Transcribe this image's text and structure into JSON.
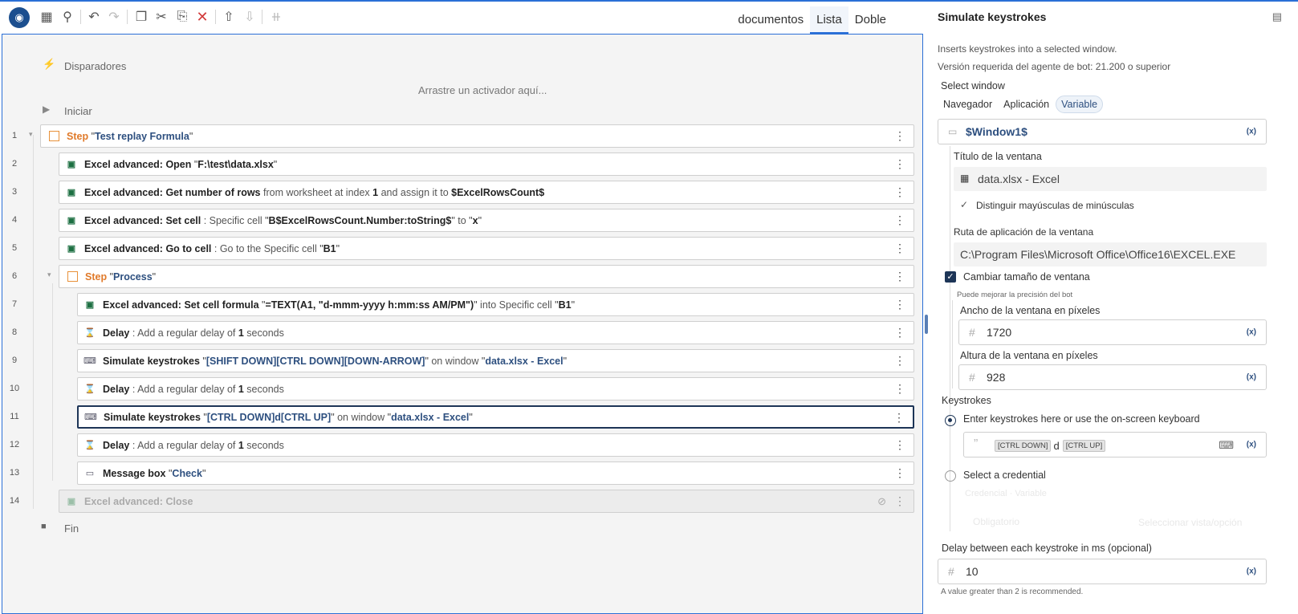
{
  "toolbar": {
    "icons": [
      "record-icon",
      "search-window-icon",
      "search-icon",
      "undo-icon",
      "redo-icon",
      "copy-icon",
      "cut-icon",
      "paste-icon",
      "delete-icon",
      "export-icon",
      "import-icon",
      "disable-icon"
    ],
    "views": [
      "documentos",
      "Lista",
      "Doble"
    ],
    "active_view": "Lista"
  },
  "canvas": {
    "triggers_label": "Disparadores",
    "drop_hint": "Arrastre un activador aquí...",
    "start_label": "Iniciar",
    "end_label": "Fin",
    "rows": [
      {
        "num": "1",
        "kind": "step",
        "parts": [
          {
            "t": "Step ",
            "c": "o"
          },
          {
            "t": "\"",
            "c": "q"
          },
          {
            "t": "Test replay Formula",
            "c": "bl"
          },
          {
            "t": "\"",
            "c": "q"
          }
        ]
      },
      {
        "num": "2",
        "kind": "excel",
        "parts": [
          {
            "t": "Excel advanced: Open ",
            "c": "b"
          },
          {
            "t": "\"",
            "c": "q"
          },
          {
            "t": "F:\\test\\data.xlsx",
            "c": "b"
          },
          {
            "t": "\"",
            "c": "q"
          }
        ]
      },
      {
        "num": "3",
        "kind": "excel",
        "parts": [
          {
            "t": "Excel advanced: Get number of rows ",
            "c": "b"
          },
          {
            "t": "from worksheet at index ",
            "c": "n"
          },
          {
            "t": "1",
            "c": "b"
          },
          {
            "t": " and assign it to ",
            "c": "n"
          },
          {
            "t": "$ExcelRowsCount$",
            "c": "b"
          }
        ]
      },
      {
        "num": "4",
        "kind": "excel",
        "parts": [
          {
            "t": "Excel advanced: Set cell",
            "c": "b"
          },
          {
            "t": " : Specific cell ",
            "c": "n"
          },
          {
            "t": "\"",
            "c": "q"
          },
          {
            "t": "B$ExcelRowsCount.Number:toString$",
            "c": "b"
          },
          {
            "t": "\"",
            "c": "q"
          },
          {
            "t": " to ",
            "c": "n"
          },
          {
            "t": "\"",
            "c": "q"
          },
          {
            "t": "x",
            "c": "b"
          },
          {
            "t": "\"",
            "c": "q"
          }
        ]
      },
      {
        "num": "5",
        "kind": "excel",
        "parts": [
          {
            "t": "Excel advanced: Go to cell",
            "c": "b"
          },
          {
            "t": " : Go to the Specific cell ",
            "c": "n"
          },
          {
            "t": "\"",
            "c": "q"
          },
          {
            "t": "B1",
            "c": "b"
          },
          {
            "t": "\"",
            "c": "q"
          }
        ]
      },
      {
        "num": "6",
        "kind": "step",
        "parts": [
          {
            "t": "Step ",
            "c": "o"
          },
          {
            "t": "\"",
            "c": "q"
          },
          {
            "t": "Process",
            "c": "bl"
          },
          {
            "t": "\"",
            "c": "q"
          }
        ]
      },
      {
        "num": "7",
        "kind": "excel",
        "parts": [
          {
            "t": "Excel advanced: Set cell formula ",
            "c": "b"
          },
          {
            "t": "\"",
            "c": "q"
          },
          {
            "t": "=TEXT(A1, \"d-mmm-yyyy h:mm:ss AM/PM\")",
            "c": "b"
          },
          {
            "t": "\"",
            "c": "q"
          },
          {
            "t": " into Specific cell ",
            "c": "n"
          },
          {
            "t": "\"",
            "c": "q"
          },
          {
            "t": "B1",
            "c": "b"
          },
          {
            "t": "\"",
            "c": "q"
          }
        ]
      },
      {
        "num": "8",
        "kind": "delay",
        "parts": [
          {
            "t": "Delay",
            "c": "b"
          },
          {
            "t": " : Add a regular delay of ",
            "c": "n"
          },
          {
            "t": "1",
            "c": "b"
          },
          {
            "t": " seconds",
            "c": "n"
          }
        ]
      },
      {
        "num": "9",
        "kind": "keys",
        "parts": [
          {
            "t": "Simulate keystrokes ",
            "c": "b"
          },
          {
            "t": "\"",
            "c": "q"
          },
          {
            "t": "[SHIFT DOWN][CTRL DOWN][DOWN-ARROW]",
            "c": "bl"
          },
          {
            "t": "\"",
            "c": "q"
          },
          {
            "t": " on window ",
            "c": "n"
          },
          {
            "t": "\"",
            "c": "q"
          },
          {
            "t": "data.xlsx - Excel",
            "c": "bl"
          },
          {
            "t": "\"",
            "c": "q"
          }
        ]
      },
      {
        "num": "10",
        "kind": "delay",
        "parts": [
          {
            "t": "Delay",
            "c": "b"
          },
          {
            "t": " : Add a regular delay of ",
            "c": "n"
          },
          {
            "t": "1",
            "c": "b"
          },
          {
            "t": " seconds",
            "c": "n"
          }
        ]
      },
      {
        "num": "11",
        "kind": "keys",
        "selected": true,
        "parts": [
          {
            "t": "Simulate keystrokes ",
            "c": "b"
          },
          {
            "t": "\"",
            "c": "q"
          },
          {
            "t": "[CTRL DOWN]d[CTRL UP]",
            "c": "bl"
          },
          {
            "t": "\"",
            "c": "q"
          },
          {
            "t": " on window ",
            "c": "n"
          },
          {
            "t": "\"",
            "c": "q"
          },
          {
            "t": "data.xlsx - Excel",
            "c": "bl"
          },
          {
            "t": "\"",
            "c": "q"
          }
        ]
      },
      {
        "num": "12",
        "kind": "delay",
        "parts": [
          {
            "t": "Delay",
            "c": "b"
          },
          {
            "t": " : Add a regular delay of ",
            "c": "n"
          },
          {
            "t": "1",
            "c": "b"
          },
          {
            "t": " seconds",
            "c": "n"
          }
        ]
      },
      {
        "num": "13",
        "kind": "msg",
        "parts": [
          {
            "t": "Message box ",
            "c": "b"
          },
          {
            "t": "\"",
            "c": "q"
          },
          {
            "t": "Check",
            "c": "bl"
          },
          {
            "t": "\"",
            "c": "q"
          }
        ]
      },
      {
        "num": "14",
        "kind": "excel",
        "disabled": true,
        "parts": [
          {
            "t": "Excel advanced: Close",
            "c": "b"
          }
        ]
      }
    ]
  },
  "panel": {
    "title": "Simulate keystrokes",
    "description": "Inserts keystrokes into a selected window.",
    "version": "Versión requerida del agente de bot: 21.200 o superior",
    "select_window_label": "Select window",
    "window_options": [
      "Navegador",
      "Aplicación",
      "Variable"
    ],
    "window_selected": "Variable",
    "window_variable": "$Window1$",
    "window_title_label": "Título de la ventana",
    "window_title_value": "data.xlsx - Excel",
    "case_label": "Distinguir mayúsculas de minúsculas",
    "app_path_label": "Ruta de aplicación de la ventana",
    "app_path_value": "C:\\Program Files\\Microsoft Office\\Office16\\EXCEL.EXE",
    "resize_label": "Cambiar tamaño de ventana",
    "resize_hint": "Puede mejorar la precisión del bot",
    "width_label": "Ancho de la ventana en píxeles",
    "width_value": "1720",
    "height_label": "Altura de la ventana en píxeles",
    "height_value": "928",
    "keystrokes_label": "Keystrokes",
    "enter_keystrokes_label": "Enter keystrokes here or use the on-screen keyboard",
    "key_tag_1": "[CTRL DOWN]",
    "key_char": "d",
    "key_tag_2": "[CTRL UP]",
    "credential_label": "Select a credential",
    "credential_ghost": "Credencial    ·  Variable",
    "credential_ghost_2": "Obligatorio",
    "credential_ghost_3": "Seleccionar vista/opción",
    "delay_label": "Delay between each keystroke in ms (opcional)",
    "delay_value": "10",
    "delay_hint": "A value greater than 2 is recommended.",
    "fx_label": "(x)"
  }
}
